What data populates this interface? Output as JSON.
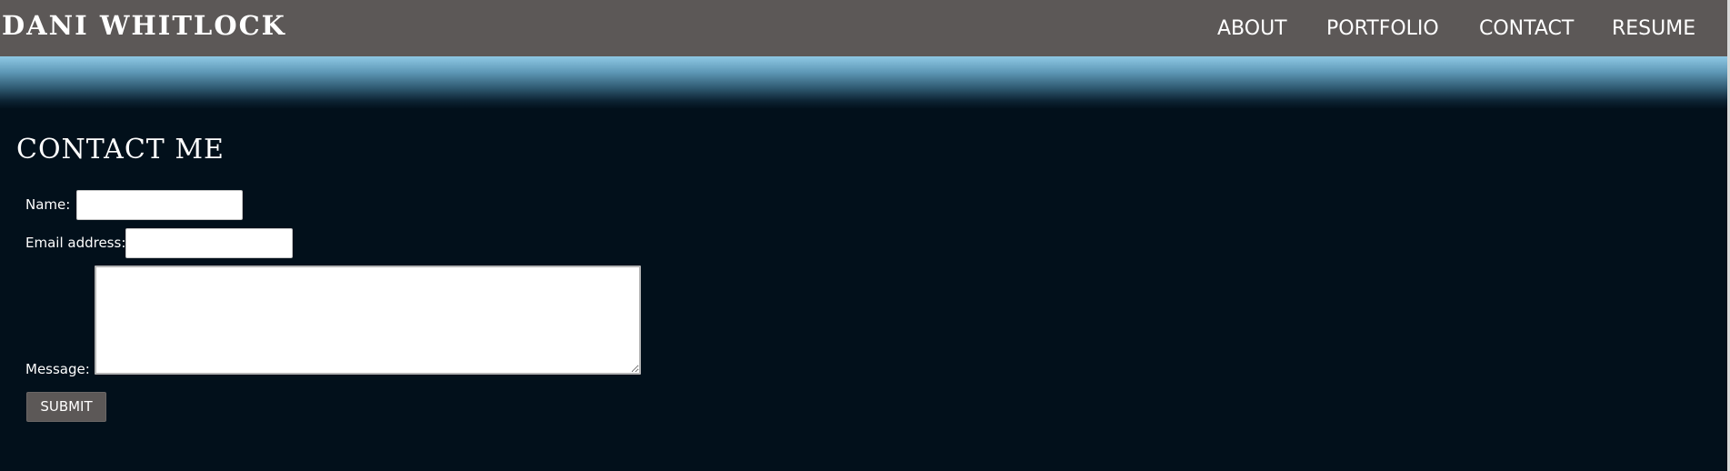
{
  "header": {
    "brand": "DANI WHITLOCK",
    "nav": [
      {
        "label": "ABOUT"
      },
      {
        "label": "PORTFOLIO"
      },
      {
        "label": "CONTACT"
      },
      {
        "label": "RESUME"
      }
    ]
  },
  "contact": {
    "title": "CONTACT ME",
    "name_label": "Name:",
    "name_value": "",
    "email_label": "Email address:",
    "email_value": "",
    "message_label": "Message:",
    "message_value": "",
    "submit_label": "SUBMIT"
  },
  "colors": {
    "header_bg": "#5c5857",
    "page_bg": "#02101b",
    "band_top": "#8ec8e4",
    "text": "#ffffff",
    "button_bg": "#5c5857"
  }
}
